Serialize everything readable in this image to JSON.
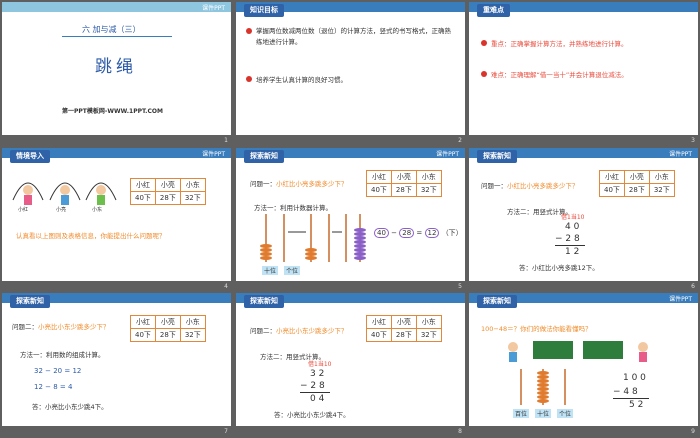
{
  "logo_text": "课件PPT",
  "slides": [
    {
      "number": "1",
      "unit": "六  加与减（三）",
      "title": "跳绳",
      "site": "第一PPT模板网-WWW.1PPT.COM"
    },
    {
      "number": "2",
      "tag": "知识目标",
      "goals": [
        "掌握两位数减两位数（退位）的计算方法，竖式的书写格式，正确熟练地进行计算。",
        "培养学生认真计算的良好习惯。"
      ]
    },
    {
      "number": "3",
      "tag": "重难点",
      "points": [
        "重点：正确掌握计算方法，并熟练地进行计算。",
        "难点：正确理解“借一当十”并会计算退位减法。"
      ]
    },
    {
      "number": "4",
      "tag": "情境导入",
      "kids": [
        "小红",
        "小亮",
        "小东"
      ],
      "question": "认真看以上图则及表格信息，你能提出什么问题呢？"
    },
    {
      "number": "5",
      "tag": "探索新知",
      "problem_label": "问题一：",
      "problem": "小红比小亮多跳多少下？",
      "method": "方法一：利用计数器计算。",
      "equation": [
        "40",
        "−",
        "28",
        "=",
        "12",
        "（下）"
      ],
      "abacus_labels": [
        "十位",
        "个位"
      ]
    },
    {
      "number": "6",
      "tag": "探索新知",
      "problem_label": "问题一：",
      "problem": "小红比小亮多跳多少下？",
      "method": "方法二：用竖式计算。",
      "borrow": "借1当10",
      "vertical": [
        "4 0",
        "− 2 8",
        "1 2"
      ],
      "answer": "答：小红比小亮多跳12下。"
    },
    {
      "number": "7",
      "tag": "探索新知",
      "problem_label": "问题二：",
      "problem": "小亮比小东少跳多少下？",
      "method": "方法一：利用数的组成计算。",
      "steps": [
        "32  −  20  =  12",
        "12  −  8  =  4"
      ],
      "answer": "答：小亮比小东少跳4下。"
    },
    {
      "number": "8",
      "tag": "探索新知",
      "problem_label": "问题二：",
      "problem": "小亮比小东少跳多少下？",
      "method": "方法二：用竖式计算。",
      "borrow": "借1当10",
      "vertical": [
        "3 2",
        "− 2 8",
        "0 4"
      ],
      "answer": "答：小亮比小东少跳4下。"
    },
    {
      "number": "9",
      "tag": "探索新知",
      "question": "100−48＝？你们的做法你能看懂吗？",
      "abacus_labels": [
        "百位",
        "十位",
        "个位"
      ],
      "vertical": [
        "1 0 0",
        "− 4 8",
        "5 2"
      ]
    }
  ],
  "table": {
    "headers": [
      "小红",
      "小亮",
      "小东"
    ],
    "values": [
      "40下",
      "28下",
      "32下"
    ]
  }
}
